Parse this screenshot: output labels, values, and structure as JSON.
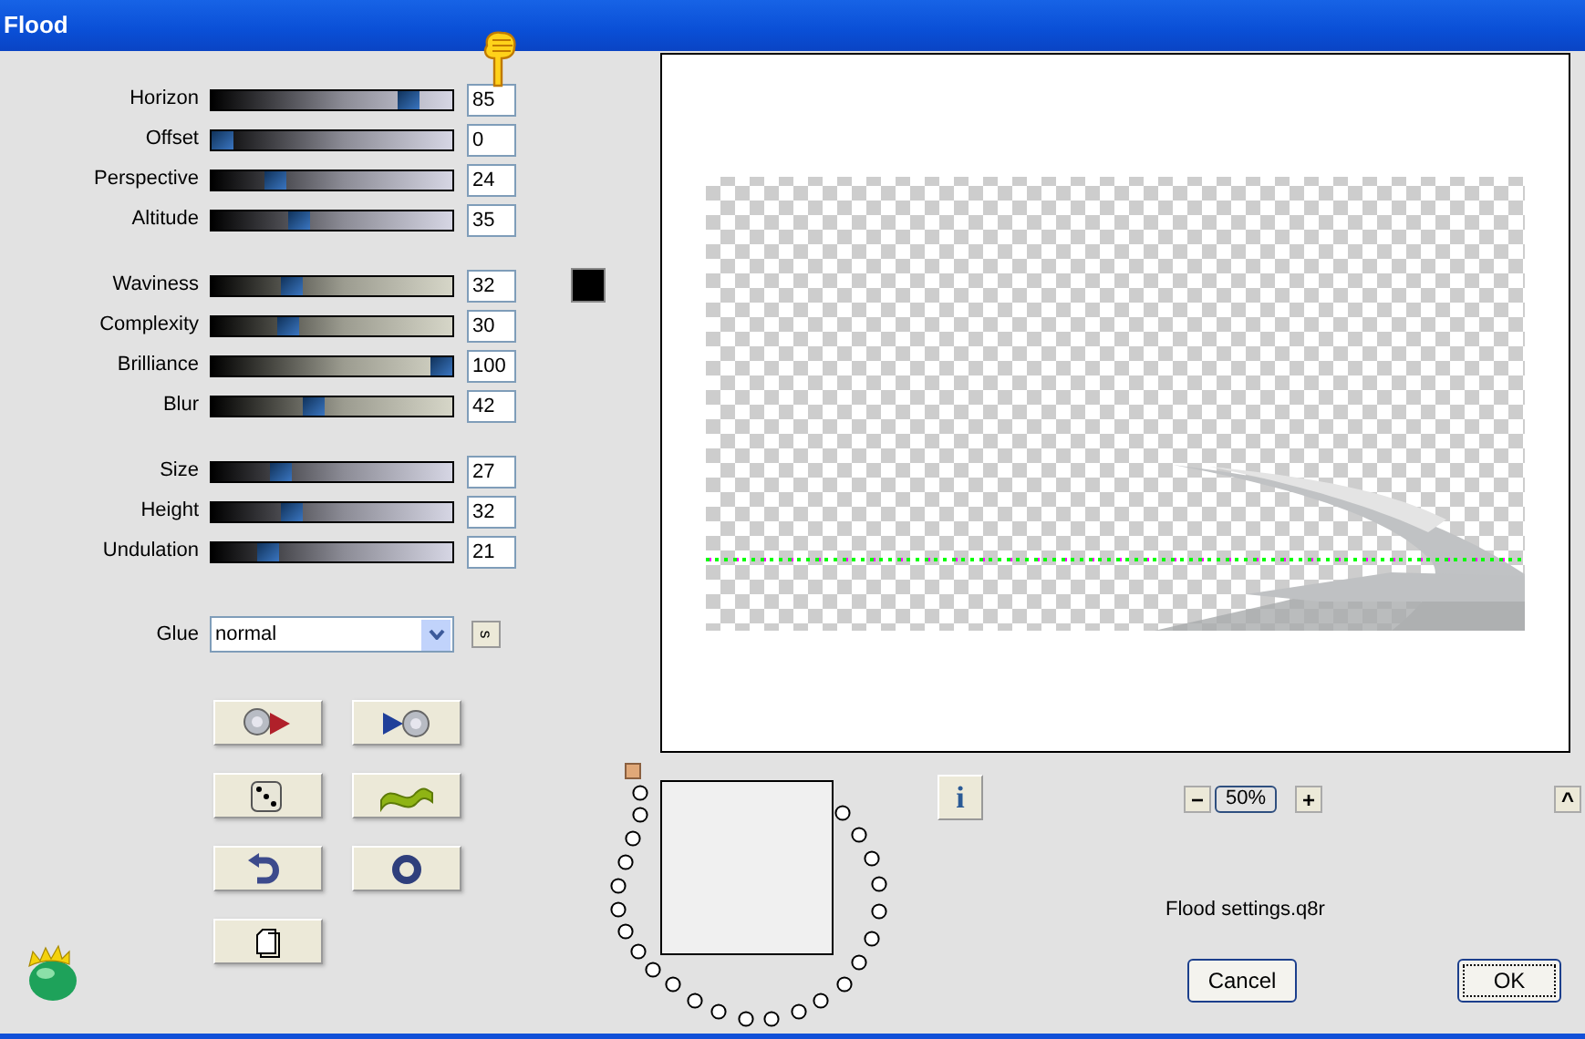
{
  "window": {
    "title": "Flood"
  },
  "slider_groups": [
    [
      {
        "label": "Horizon",
        "value": "85",
        "level": 0.85
      },
      {
        "label": "Offset",
        "value": "0",
        "level": 0
      },
      {
        "label": "Perspective",
        "value": "24",
        "level": 0.24
      },
      {
        "label": "Altitude",
        "value": "35",
        "level": 0.35
      }
    ],
    [
      {
        "label": "Waviness",
        "value": "32",
        "level": 0.32
      },
      {
        "label": "Complexity",
        "value": "30",
        "level": 0.3
      },
      {
        "label": "Brilliance",
        "value": "100",
        "level": 1
      },
      {
        "label": "Blur",
        "value": "42",
        "level": 0.42
      }
    ],
    [
      {
        "label": "Size",
        "value": "27",
        "level": 0.27
      },
      {
        "label": "Height",
        "value": "32",
        "level": 0.32
      },
      {
        "label": "Undulation",
        "value": "21",
        "level": 0.21
      }
    ]
  ],
  "color_swatch": {
    "color": "#000000"
  },
  "glue": {
    "label": "Glue",
    "value": "normal",
    "side_button": "s"
  },
  "info_button": "i",
  "zoom": {
    "minus": "−",
    "value": "50%",
    "plus": "+",
    "collapse": "^"
  },
  "settings_file": "Flood settings.q8r",
  "buttons": [
    "Cancel",
    "OK"
  ]
}
